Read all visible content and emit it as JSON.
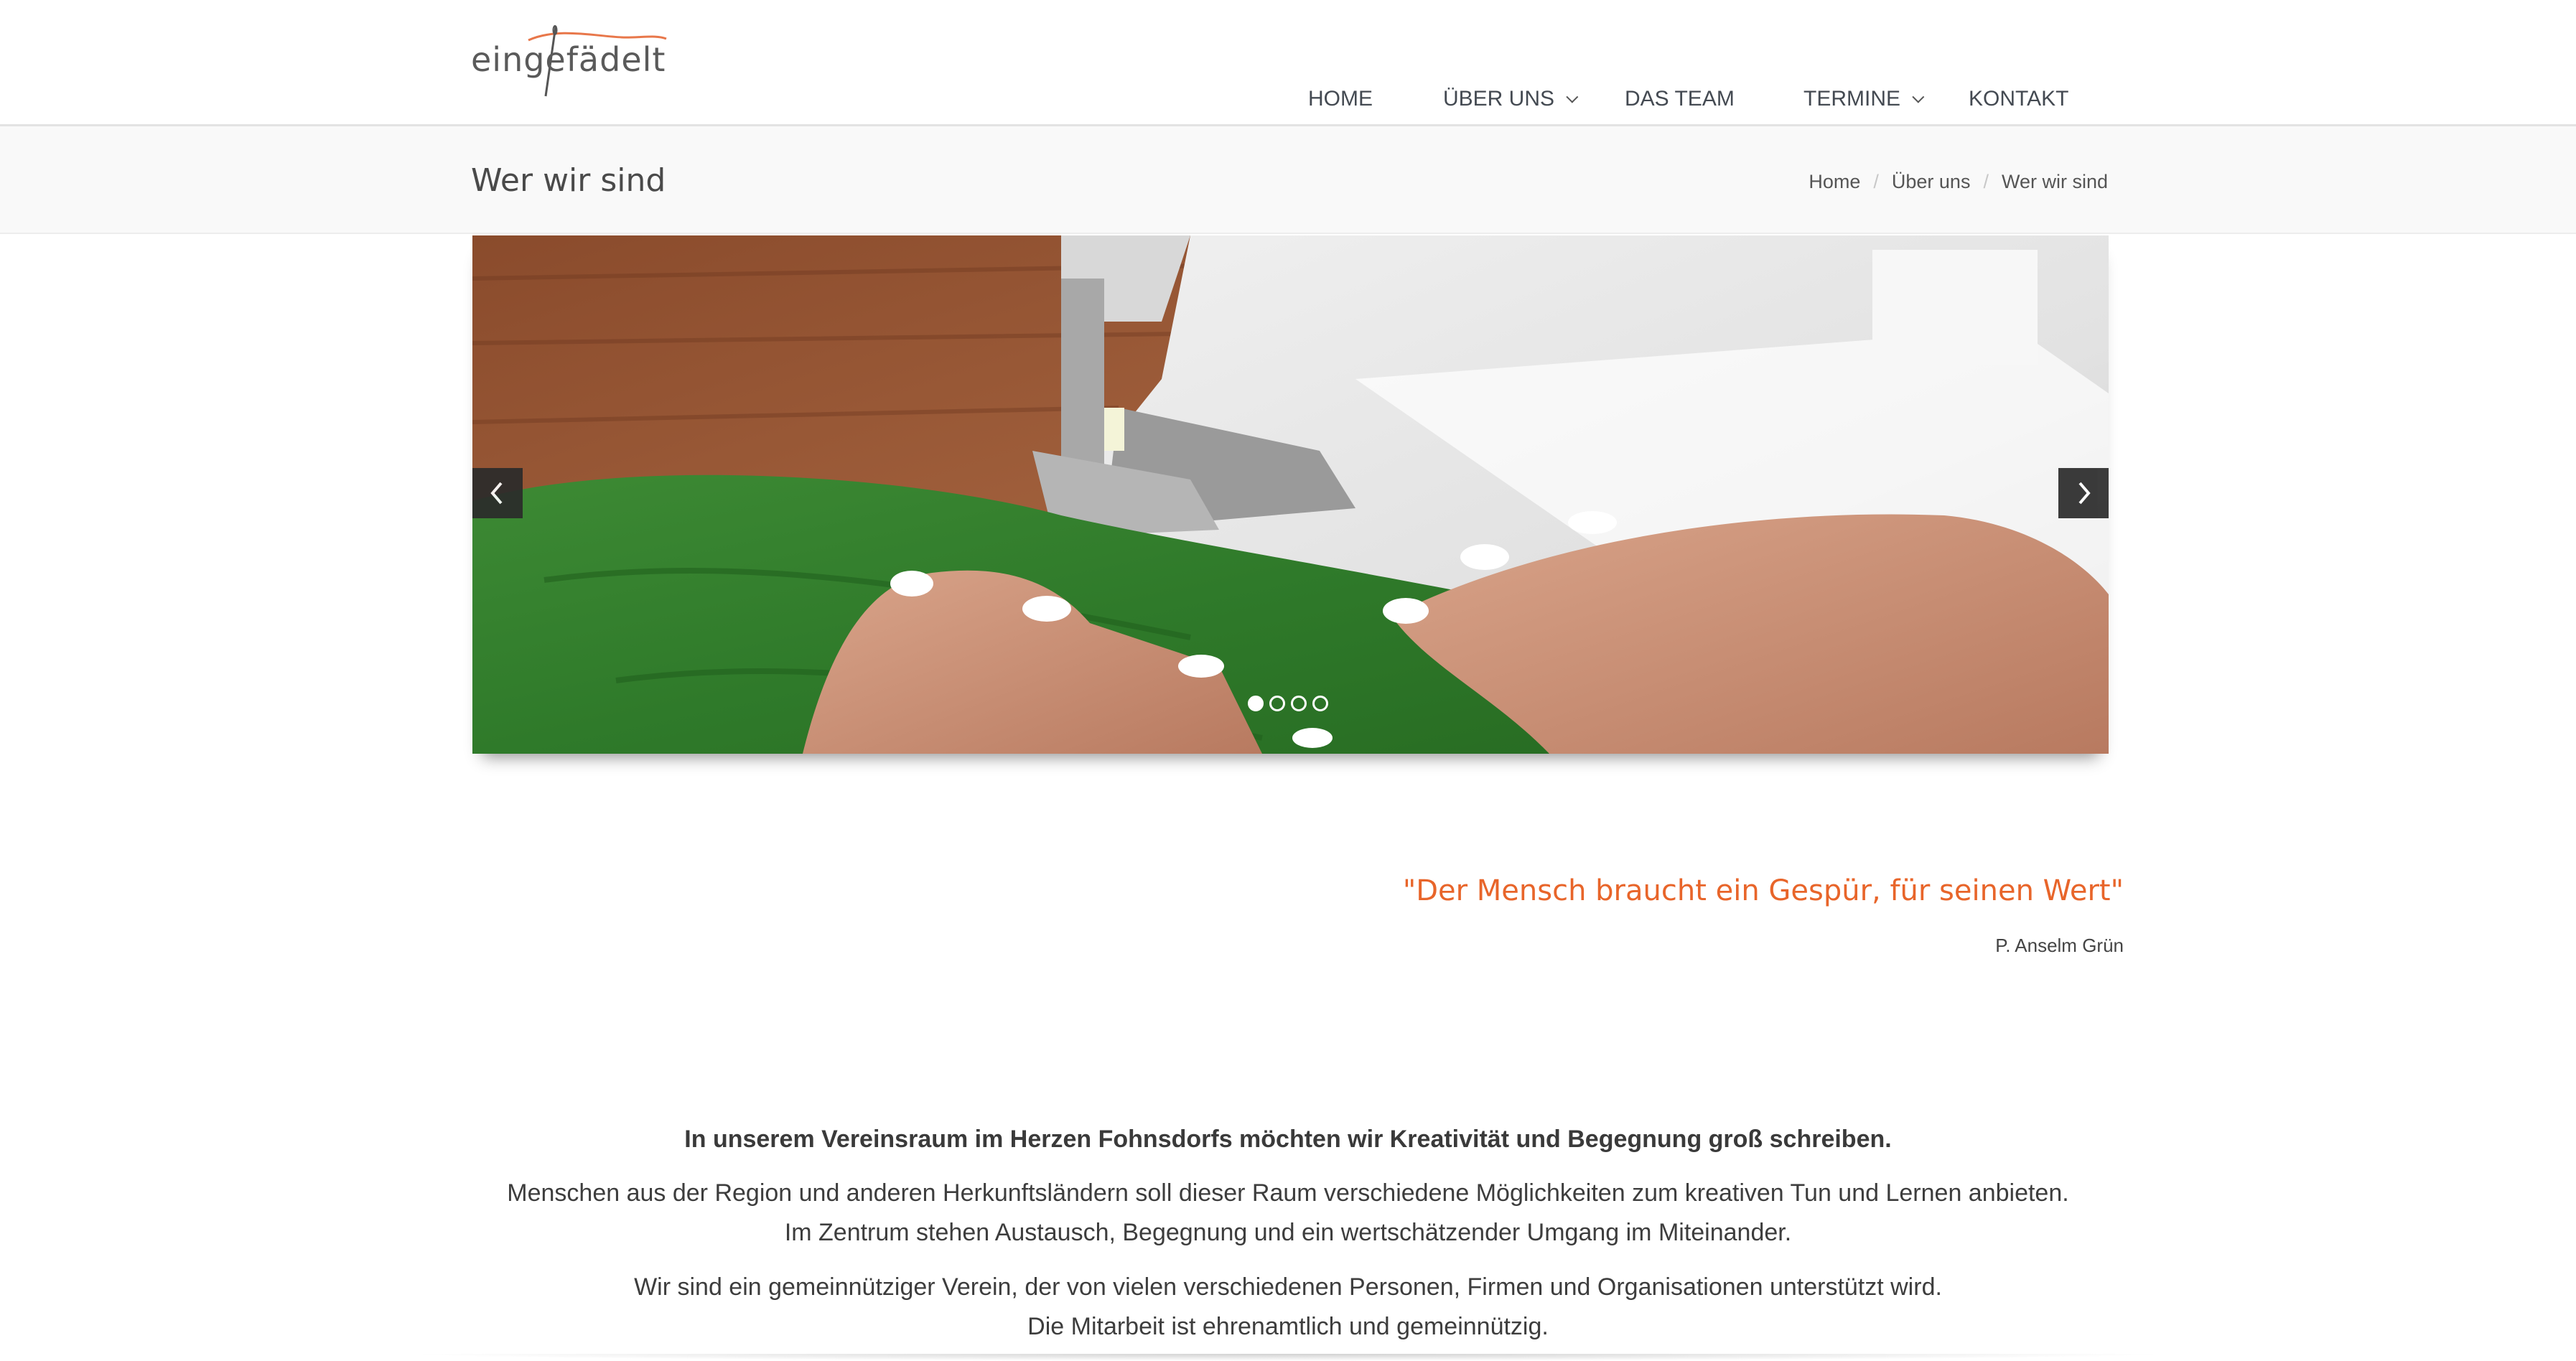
{
  "logo": {
    "text": "eingefädelt"
  },
  "nav": {
    "items": [
      {
        "label": "HOME",
        "has_dropdown": false
      },
      {
        "label": "ÜBER UNS",
        "has_dropdown": true
      },
      {
        "label": "DAS TEAM",
        "has_dropdown": false
      },
      {
        "label": "TERMINE",
        "has_dropdown": true
      },
      {
        "label": "KONTAKT",
        "has_dropdown": false
      }
    ]
  },
  "page": {
    "title": "Wer wir sind",
    "breadcrumb": [
      "Home",
      "Über uns",
      "Wer wir sind"
    ],
    "breadcrumb_separator": "/"
  },
  "slider": {
    "prev_icon": "chevron-left-icon",
    "next_icon": "chevron-right-icon",
    "slide_count": 4,
    "active_index": 0
  },
  "quote": {
    "text": "\"Der Mensch braucht ein Gespür, für seinen Wert\"",
    "author": "P. Anselm Grün"
  },
  "content": {
    "lead": "In unserem Vereinsraum im Herzen Fohnsdorfs möchten wir Kreativität und Begegnung groß schreiben.",
    "paragraph1": [
      "Menschen aus der Region und anderen Herkunftsländern soll dieser Raum verschiedene Möglichkeiten zum kreativen Tun und Lernen anbieten.",
      "Im Zentrum stehen Austausch, Begegnung und ein wertschätzender Umgang im Miteinander."
    ],
    "paragraph2": [
      "Wir sind ein gemeinnütziger Verein, der von vielen verschiedenen Personen, Firmen und Organisationen unterstützt wird.",
      "Die Mitarbeit ist ehrenamtlich und gemeinnützig."
    ]
  },
  "colors": {
    "accent": "#e8652a",
    "nav_text": "#444a52",
    "titlebar_bg": "#f9f9f9"
  }
}
